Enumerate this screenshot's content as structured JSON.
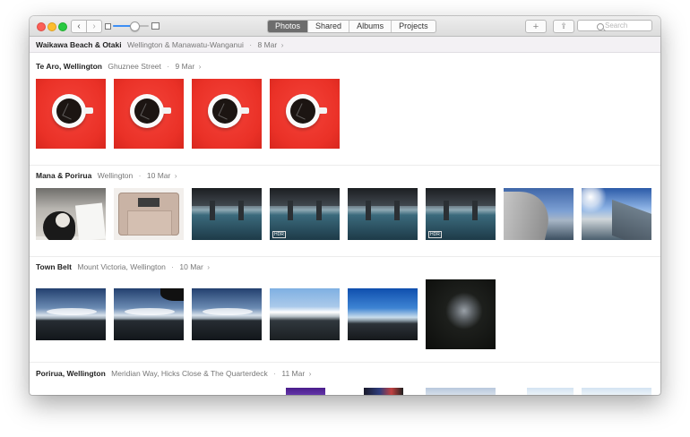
{
  "toolbar": {
    "back_glyph": "‹",
    "forward_glyph": "›",
    "tabs": [
      {
        "label": "Photos",
        "active": true
      },
      {
        "label": "Shared",
        "active": false
      },
      {
        "label": "Albums",
        "active": false
      },
      {
        "label": "Projects",
        "active": false
      }
    ],
    "add_glyph": "+",
    "share_glyph": "⇪",
    "search_placeholder": "Search",
    "zoom_level": 0.6
  },
  "pinned_header": {
    "title": "Waikawa Beach & Otaki",
    "location": "Wellington & Manawatu-Wanganui",
    "separator": "·",
    "date": "8 Mar",
    "chevron": "›"
  },
  "moments": [
    {
      "title": "Te Aro, Wellington",
      "location": "Ghuznee Street",
      "separator": "·",
      "date": "9 Mar",
      "chevron": "›",
      "photos": [
        "coffee-cup",
        "coffee-cup",
        "coffee-cup",
        "coffee-cup"
      ]
    },
    {
      "title": "Mana & Porirua",
      "location": "Wellington",
      "separator": "·",
      "date": "10 Mar",
      "chevron": "›",
      "photos": [
        "cat-on-desk",
        "laptop-internals",
        "bridge-underside",
        "bridge-underside-hdr",
        "bridge-underside",
        "bridge-underside-hdr",
        "bridge-blue-sky",
        "bridge-sun"
      ],
      "hdr_label": "HDR"
    },
    {
      "title": "Town Belt",
      "location": "Mount Victoria, Wellington",
      "separator": "·",
      "date": "10 Mar",
      "chevron": "›",
      "photos": [
        "sunset-sky",
        "sunset-sky-tree",
        "sunset-sky",
        "sunset-bright",
        "sunset-blue",
        "trees-silhouette"
      ]
    },
    {
      "title": "Porirua, Wellington",
      "location": "Meridian Way, Hicks Close & The Quarterdeck",
      "separator": "·",
      "date": "11 Mar",
      "chevron": "›",
      "photos": [
        "purple-screen",
        "device-screen",
        "sky-light",
        "sky-pale",
        "sky-pale"
      ]
    }
  ]
}
